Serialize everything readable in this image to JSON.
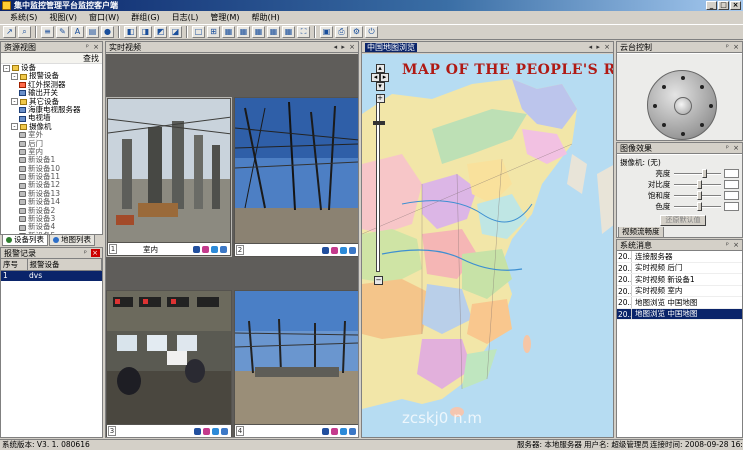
{
  "window": {
    "title": "集中监控管理平台监控客户端"
  },
  "menu": [
    "系统(S)",
    "视图(V)",
    "窗口(W)",
    "群组(G)",
    "日志(L)",
    "管理(M)",
    "帮助(H)"
  ],
  "panels": {
    "resource": "资源视图",
    "search": "查找",
    "alarm": "报警记录",
    "video": "实时视频",
    "map": "中国地图浏览",
    "ptz": "云台控制",
    "effect": "图像效果",
    "sysmsg": "系统消息"
  },
  "tree": [
    {
      "label": "设备",
      "level": 0,
      "type": "folder",
      "toggle": "-"
    },
    {
      "label": "报警设备",
      "level": 1,
      "type": "folder",
      "toggle": "-"
    },
    {
      "label": "红外探测器",
      "level": 2,
      "type": "sensor"
    },
    {
      "label": "输出开关",
      "level": 2,
      "type": "dev"
    },
    {
      "label": "其它设备",
      "level": 1,
      "type": "folder",
      "toggle": "-"
    },
    {
      "label": "海康电视服务器",
      "level": 2,
      "type": "dev"
    },
    {
      "label": "电视墙",
      "level": 2,
      "type": "dev"
    },
    {
      "label": "摄像机",
      "level": 1,
      "type": "folder",
      "toggle": "-"
    },
    {
      "label": "室外",
      "level": 2,
      "type": "cam",
      "gray": true
    },
    {
      "label": "后门",
      "level": 2,
      "type": "cam",
      "gray": true
    },
    {
      "label": "室内",
      "level": 2,
      "type": "cam",
      "gray": true
    },
    {
      "label": "新设备1",
      "level": 2,
      "type": "cam",
      "gray": true
    },
    {
      "label": "新设备10",
      "level": 2,
      "type": "cam",
      "gray": true
    },
    {
      "label": "新设备11",
      "level": 2,
      "type": "cam",
      "gray": true
    },
    {
      "label": "新设备12",
      "level": 2,
      "type": "cam",
      "gray": true
    },
    {
      "label": "新设备13",
      "level": 2,
      "type": "cam",
      "gray": true
    },
    {
      "label": "新设备14",
      "level": 2,
      "type": "cam",
      "gray": true
    },
    {
      "label": "新设备2",
      "level": 2,
      "type": "cam",
      "gray": true
    },
    {
      "label": "新设备3",
      "level": 2,
      "type": "cam",
      "gray": true
    },
    {
      "label": "新设备4",
      "level": 2,
      "type": "cam",
      "gray": true
    },
    {
      "label": "新设备5",
      "level": 2,
      "type": "cam",
      "gray": true
    }
  ],
  "lefttabs": [
    "设备列表",
    "地图列表"
  ],
  "alarm": {
    "columns": [
      "序号",
      "报警设备"
    ],
    "rows": [
      [
        "1",
        "dvs"
      ]
    ]
  },
  "video": {
    "cells": [
      {
        "num": "1",
        "name": "室内"
      },
      {
        "num": "2",
        "name": ""
      },
      {
        "num": "3",
        "name": ""
      },
      {
        "num": "4",
        "name": ""
      }
    ]
  },
  "map": {
    "title": "MAP OF THE PEOPLE'S REPUBLIC OF CHI",
    "watermark": "zcskj0  n.m  "
  },
  "effect": {
    "camera": "摄像机: (无)",
    "rows": [
      {
        "label": "亮度",
        "level": 0.62
      },
      {
        "label": "对比度",
        "level": 0.5
      },
      {
        "label": "饱和度",
        "level": 0.5
      },
      {
        "label": "色度",
        "level": 0.5
      }
    ],
    "reset": "还原默认值",
    "fluency": "视频流畅度"
  },
  "sysmsg": [
    {
      "time": "20...",
      "text": "连接服务器"
    },
    {
      "time": "20...",
      "text": "实时视频  后门"
    },
    {
      "time": "20...",
      "text": "实时视频  新设备1"
    },
    {
      "time": "20...",
      "text": "实时视频  室内"
    },
    {
      "time": "20...",
      "text": "地图浏览  中国地图"
    },
    {
      "time": "20...",
      "text": "地图浏览 中国地图",
      "selected": true
    }
  ],
  "status": {
    "version": "系统版本: V3. 1. 080616",
    "server": "服务器: 本地服务器",
    "user": "用户名: 超级管理员",
    "conn": "连接时间: 2008-09-28 16:12:32"
  },
  "colors": {
    "title": "#0a246a",
    "selection": "#0a246a",
    "mapTitle": "#b01a14"
  }
}
